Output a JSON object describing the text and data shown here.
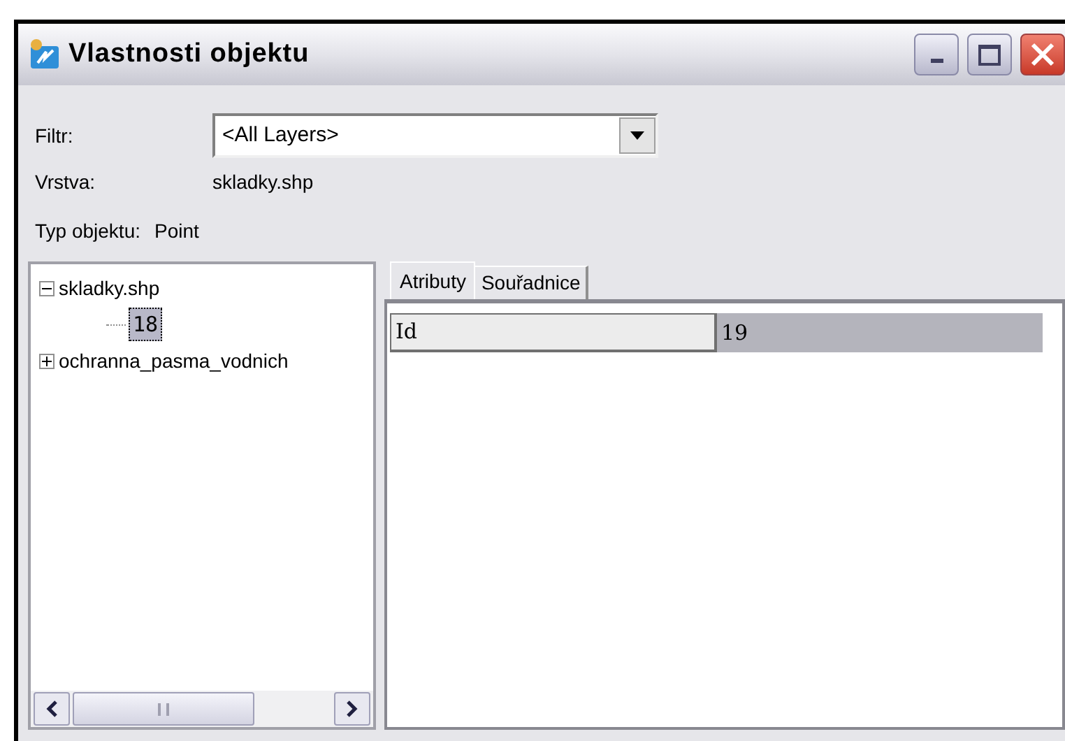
{
  "window": {
    "title": "Vlastnosti objektu"
  },
  "filter": {
    "label": "Filtr:",
    "value": "<All Layers>"
  },
  "fields": [
    {
      "label": "Vrstva:",
      "value": "skladky.shp"
    },
    {
      "label": "Typ objektu:",
      "value": "Point"
    }
  ],
  "tree": [
    {
      "label": "skladky.shp",
      "expanded": true,
      "selected": false,
      "children": [
        {
          "label": "18",
          "selected": true
        }
      ]
    },
    {
      "label": "ochranna_pasma_vodnich",
      "expanded": false,
      "selected": false
    }
  ],
  "tabs": [
    {
      "label": "Atributy",
      "selected": true
    },
    {
      "label": "Souřadnice",
      "selected": false
    }
  ],
  "attributes": [
    {
      "name": "Id",
      "value": "19"
    }
  ]
}
